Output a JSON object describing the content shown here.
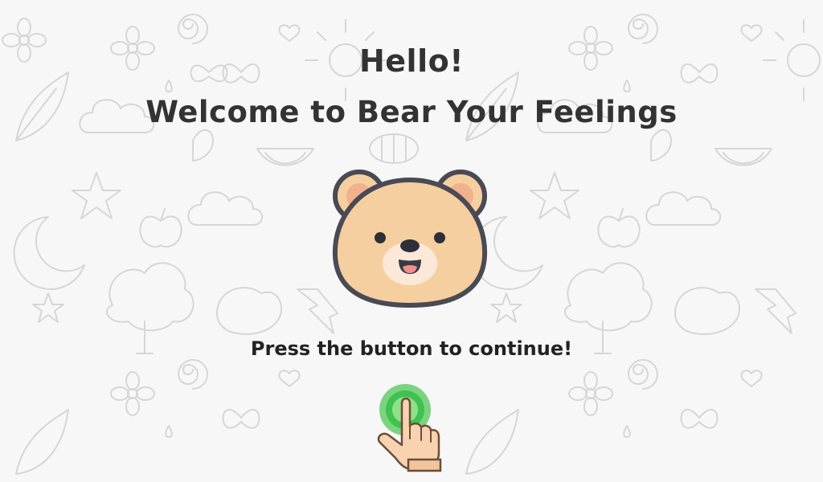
{
  "greeting": "Hello!",
  "welcome": "Welcome to Bear Your Feelings",
  "prompt": "Press the button to continue!",
  "colors": {
    "background": "#f7f7f7",
    "doodle": "#d4d4d4",
    "text": "#333333",
    "bear_fur": "#f5cfa0",
    "bear_outline": "#4a4a55",
    "button_green": "#3fc24f",
    "hand_skin": "#f9d3b0"
  },
  "icons": {
    "bear": "bear-face-icon",
    "button": "tap-button-icon",
    "hand": "pointing-hand-icon"
  }
}
